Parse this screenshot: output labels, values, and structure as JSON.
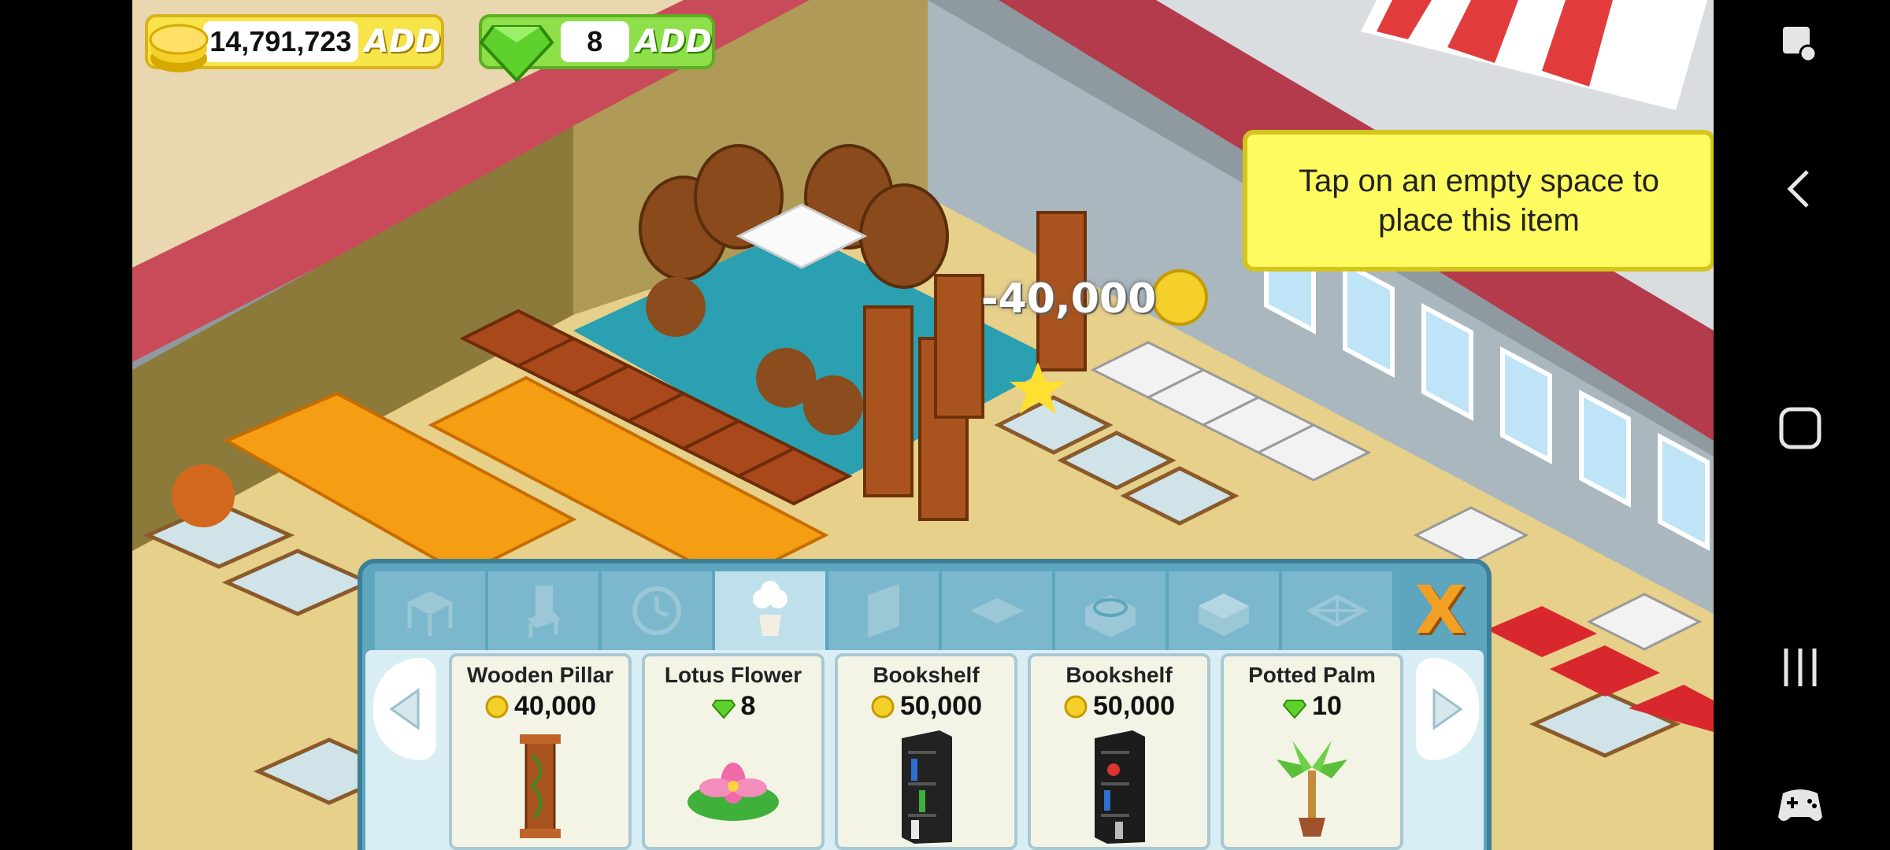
{
  "hud": {
    "coins": "14,791,723",
    "coins_add": "ADD",
    "gems": "8",
    "gems_add": "ADD"
  },
  "tooltip": "Tap on an empty space to place this item",
  "floating_price": "-40,000",
  "shop": {
    "tabs": [
      "table-icon",
      "chair-icon",
      "clock-icon",
      "plant-icon",
      "wall-icon",
      "floor-icon",
      "stove-icon",
      "counter-icon",
      "expand-icon"
    ],
    "active_tab": 3,
    "close_label": "X",
    "items": [
      {
        "name": "Wooden Pillar",
        "currency": "coin",
        "price": "40,000"
      },
      {
        "name": "Lotus Flower",
        "currency": "gem",
        "price": "8"
      },
      {
        "name": "Bookshelf",
        "currency": "coin",
        "price": "50,000"
      },
      {
        "name": "Bookshelf",
        "currency": "coin",
        "price": "50,000"
      },
      {
        "name": "Potted Palm",
        "currency": "gem",
        "price": "10"
      }
    ]
  },
  "colors": {
    "coin": "#f5cf2a",
    "gem": "#5fd12d",
    "panel": "#5ea5be",
    "tooltip": "#fdfb5f"
  },
  "system_nav": [
    "screenshot-icon",
    "back-icon",
    "home-icon",
    "recents-icon",
    "game-tools-icon"
  ]
}
